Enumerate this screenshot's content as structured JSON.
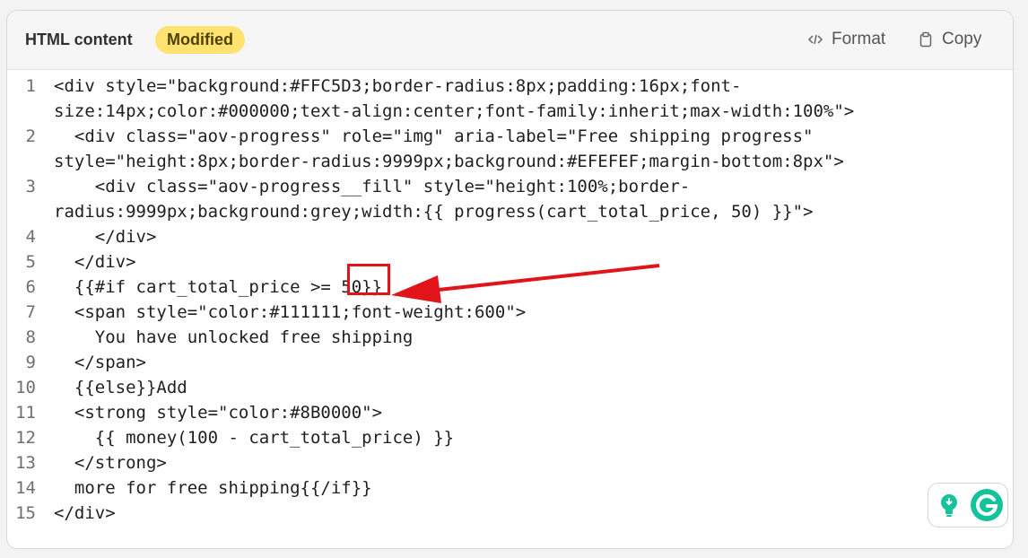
{
  "header": {
    "title": "HTML content",
    "badge": "Modified",
    "format_label": "Format",
    "copy_label": "Copy"
  },
  "colors": {
    "badge_bg": "#FFE26F",
    "annotation_red": "#E1141A",
    "grammarly_green": "#15C39A"
  },
  "code_lines": [
    {
      "num": "1",
      "text": "<div style=\"background:#FFC5D3;border-radius:8px;padding:16px;font-"
    },
    {
      "num": "",
      "text": "size:14px;color:#000000;text-align:center;font-family:inherit;max-width:100%\">"
    },
    {
      "num": "2",
      "text": "  <div class=\"aov-progress\" role=\"img\" aria-label=\"Free shipping progress\""
    },
    {
      "num": "",
      "text": "style=\"height:8px;border-radius:9999px;background:#EFEFEF;margin-bottom:8px\">"
    },
    {
      "num": "3",
      "text": "    <div class=\"aov-progress__fill\" style=\"height:100%;border-"
    },
    {
      "num": "",
      "text": "radius:9999px;background:grey;width:{{ progress(cart_total_price, 50) }}\">"
    },
    {
      "num": "4",
      "text": "    </div>"
    },
    {
      "num": "5",
      "text": "  </div>"
    },
    {
      "num": "6",
      "text": "  {{#if cart_total_price >= 50}}"
    },
    {
      "num": "7",
      "text": "  <span style=\"color:#111111;font-weight:600\">"
    },
    {
      "num": "8",
      "text": "    You have unlocked free shipping"
    },
    {
      "num": "9",
      "text": "  </span>"
    },
    {
      "num": "10",
      "text": "  {{else}}Add"
    },
    {
      "num": "11",
      "text": "  <strong style=\"color:#8B0000\">"
    },
    {
      "num": "12",
      "text": "    {{ money(100 - cart_total_price) }}"
    },
    {
      "num": "13",
      "text": "  </strong>"
    },
    {
      "num": "14",
      "text": "  more for free shipping{{/if}}"
    },
    {
      "num": "15",
      "text": "</div>"
    }
  ],
  "icons": {
    "format": "code-icon",
    "copy": "clipboard-icon",
    "grammarly_assist": "lightbulb-icon",
    "grammarly": "grammarly-logo-icon"
  }
}
